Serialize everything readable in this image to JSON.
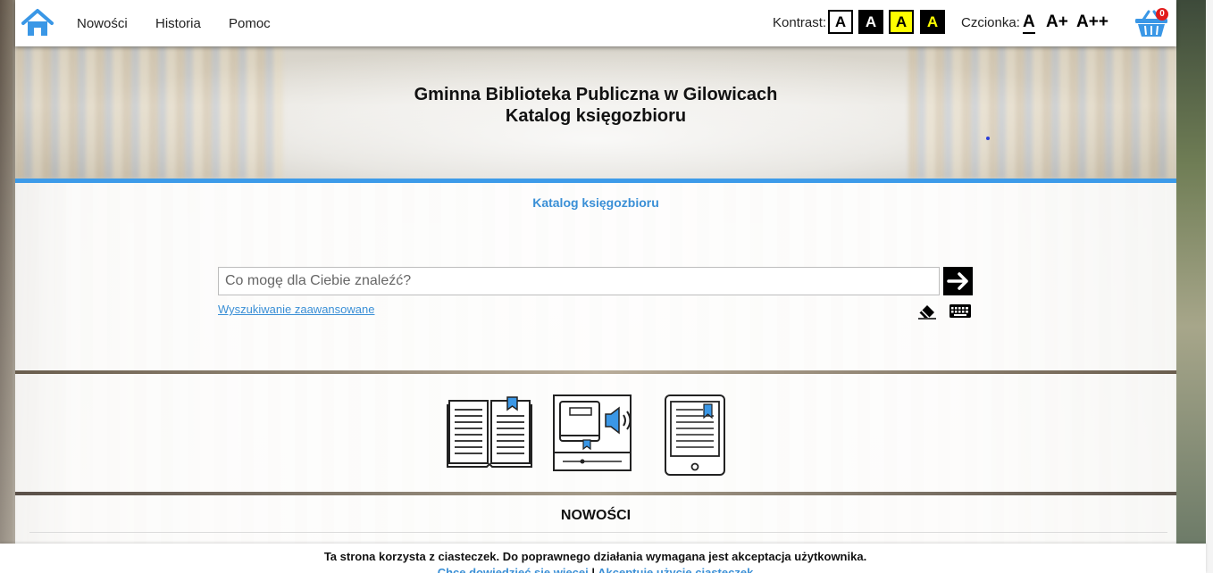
{
  "colors": {
    "accent": "#3d9be9",
    "link": "#3a8fd6",
    "badge": "#e21b1b",
    "contrast_yellow": "#ffff00"
  },
  "nav": {
    "home_icon": "home-icon",
    "items": [
      {
        "label": "Nowości"
      },
      {
        "label": "Historia"
      },
      {
        "label": "Pomoc"
      }
    ]
  },
  "accessibility": {
    "contrast_label": "Kontrast:",
    "contrast_options": [
      "A",
      "A",
      "A",
      "A"
    ],
    "font_label": "Czcionka:",
    "font_options": [
      "A",
      "A+",
      "A++"
    ]
  },
  "cart": {
    "icon": "basket-icon",
    "count": "0"
  },
  "header": {
    "title_line1": "Gminna Biblioteka Publiczna w Gilowicach",
    "title_line2": "Katalog księgozbioru"
  },
  "main": {
    "caption": "Katalog księgozbioru",
    "search": {
      "placeholder": "Co mogę dla Ciebie znaleźć?",
      "value": ""
    },
    "advanced_link": "Wyszukiwanie zaawansowane",
    "media_types": [
      {
        "icon": "open-book-icon"
      },
      {
        "icon": "audiobook-icon"
      },
      {
        "icon": "ebook-reader-icon"
      }
    ],
    "news_heading": "NOWOŚCI"
  },
  "cookie": {
    "message": "Ta strona korzysta z ciasteczek. Do poprawnego działania wymagana jest akceptacja użytkownika.",
    "more_link": "Chcę dowiedzieć się więcej",
    "separator": " | ",
    "accept_link": "Akceptuję użycie ciasteczek"
  }
}
